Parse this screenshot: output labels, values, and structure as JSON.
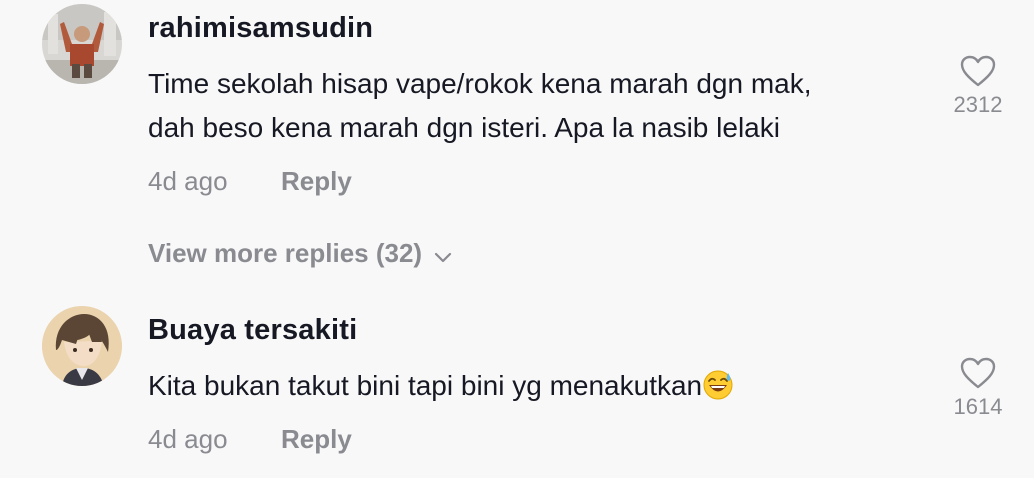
{
  "comments": [
    {
      "username": "rahimisamsudin",
      "text_lines": [
        "Time sekolah hisap vape/rokok kena marah dgn mak,",
        "dah beso kena marah dgn isteri. Apa la nasib lelaki"
      ],
      "time": "4d ago",
      "reply_label": "Reply",
      "view_more": "View more replies (32)",
      "likes": "2312"
    },
    {
      "username": "Buaya tersakiti",
      "text": "Kita bukan takut bini tapi bini yg menakutkan",
      "emoji": "😅",
      "time": "4d ago",
      "reply_label": "Reply",
      "likes": "1614"
    }
  ],
  "colors": {
    "background": "#f8f8f8",
    "primary_text": "#161823",
    "secondary_text": "#8a8b91"
  }
}
